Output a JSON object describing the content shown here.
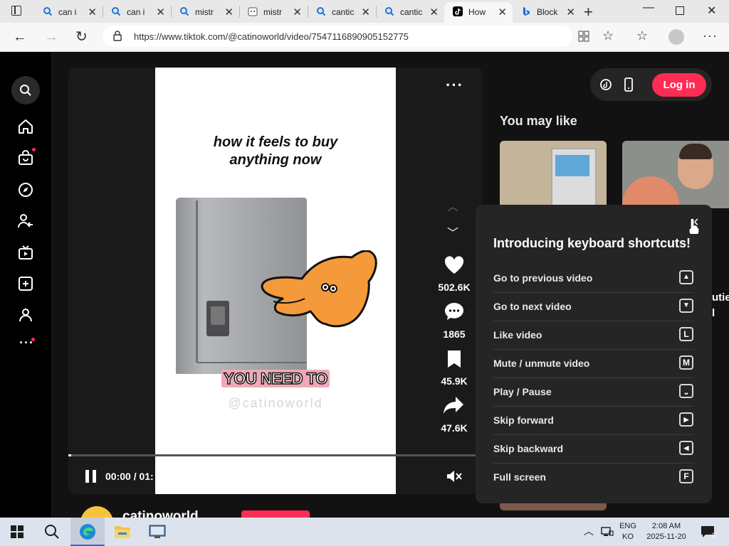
{
  "browser": {
    "tabs": [
      {
        "label": "can i",
        "icon": "search-icon"
      },
      {
        "label": "can i",
        "icon": "search-icon"
      },
      {
        "label": "mistr",
        "icon": "search-icon"
      },
      {
        "label": "mistr",
        "icon": "cat-icon"
      },
      {
        "label": "cantic",
        "icon": "search-icon"
      },
      {
        "label": "cantic",
        "icon": "search-icon"
      },
      {
        "label": "How",
        "icon": "tiktok-icon"
      },
      {
        "label": "Block",
        "icon": "bing-icon"
      }
    ],
    "url": "https://www.tiktok.com/@catinoworld/video/7547116890905152775"
  },
  "header": {
    "login_label": "Log in"
  },
  "video": {
    "caption_line1": "how it feels to buy",
    "caption_line2": "anything now",
    "subtitle": "YOU NEED TO",
    "watermark": "@catinoworld",
    "time": "00:00 / 01:",
    "likes": "502.6K",
    "comments": "1865",
    "saves": "45.9K",
    "shares": "47.6K",
    "author": "catinoworld",
    "progress_percent": 0
  },
  "recommend": {
    "title": "You may like",
    "peek_text_1": "utie",
    "peek_text_2": "l"
  },
  "shortcuts": {
    "title": "Introducing keyboard shortcuts!",
    "items": [
      {
        "label": "Go to previous video",
        "key": "▲"
      },
      {
        "label": "Go to next video",
        "key": "▼"
      },
      {
        "label": "Like video",
        "key": "L"
      },
      {
        "label": "Mute / unmute video",
        "key": "M"
      },
      {
        "label": "Play / Pause",
        "key": "⎵"
      },
      {
        "label": "Skip forward",
        "key": "▶"
      },
      {
        "label": "Skip backward",
        "key": "◀"
      },
      {
        "label": "Full screen",
        "key": "F"
      }
    ]
  },
  "taskbar": {
    "lang1": "ENG",
    "lang2": "KO",
    "time": "2:08 AM",
    "date": "2025-11-20",
    "notif_count": "3"
  },
  "colors": {
    "accent": "#fe2c55",
    "panel": "#252525",
    "page_bg": "#121212"
  }
}
